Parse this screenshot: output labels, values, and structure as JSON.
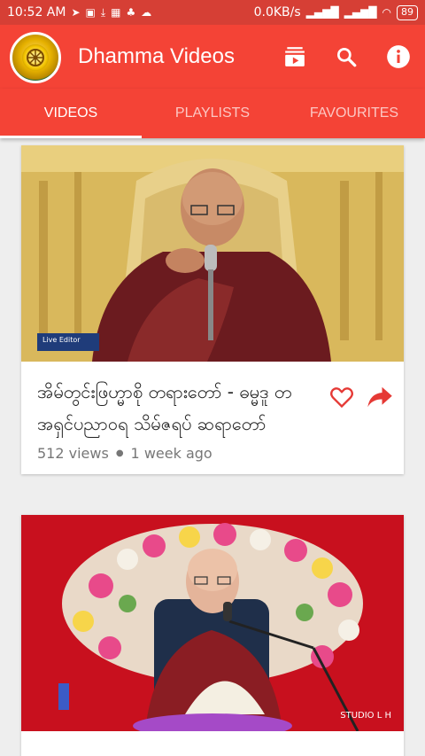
{
  "status_bar": {
    "time": "10:52 AM",
    "network_speed": "0.0KB/s",
    "battery": "89"
  },
  "app_bar": {
    "title": "Dhamma Videos",
    "actions": [
      "subscriptions-icon",
      "search-icon",
      "info-icon"
    ]
  },
  "tabs": [
    {
      "label": "VIDEOS",
      "active": true
    },
    {
      "label": "PLAYLISTS",
      "active": false
    },
    {
      "label": "FAVOURITES",
      "active": false
    }
  ],
  "videos": [
    {
      "title": "အိမ်တွင်းဖြဟ္မာစို တရားတော် - ဓမ္မဒူ တအရှင်ပညာဝရ  သိမ်ဇရပ် ဆရာတော်",
      "views": "512 views",
      "age": "1 week ago",
      "thumb_caption": "Live Editor"
    },
    {
      "title": "",
      "thumb_caption": "STUDIO L H"
    }
  ],
  "colors": {
    "primary": "#f44336",
    "status_bar": "#d63f35",
    "accent": "#f44336"
  }
}
